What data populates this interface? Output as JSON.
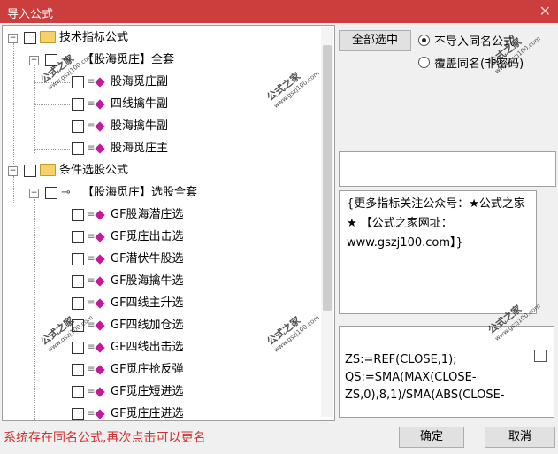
{
  "window": {
    "title": "导入公式",
    "close_glyph": "✕"
  },
  "tree": {
    "groups": [
      {
        "label": "技术指标公式",
        "sub": {
          "label": "【股海觅庄】全套",
          "items": [
            "股海觅庄副",
            "四线擒牛副",
            "股海擒牛副",
            "股海觅庄主"
          ]
        }
      },
      {
        "label": "条件选股公式",
        "sub": {
          "label": "【股海觅庄】选股全套",
          "items": [
            "GF股海潜庄选",
            "GF觅庄出击选",
            "GF潜伏牛股选",
            "GF股海擒牛选",
            "GF四线主升选",
            "GF四线加仓选",
            "GF四线出击选",
            "GF觅庄抢反弹",
            "GF觅庄短进选",
            "GF觅庄庄进选"
          ]
        }
      }
    ]
  },
  "watermark": {
    "main": "公式之家",
    "url": "www.gszj100.com"
  },
  "right": {
    "select_all": "全部选中",
    "options": [
      {
        "label": "不导入同名公式",
        "checked": true
      },
      {
        "label": "覆盖同名(非密码)",
        "checked": false
      }
    ],
    "description": "{更多指标关注公众号：★公式之家★ 【公式之家网址：www.gszj100.com】}",
    "code_lines": [
      "ZS:=REF(CLOSE,1);",
      "QS:=SMA(MAX(CLOSE-",
      "ZS,0),8,1)/SMA(ABS(CLOSE-"
    ]
  },
  "footer": {
    "status": "系统存在同名公式,再次点击可以更名",
    "ok": "确定",
    "cancel": "取消"
  },
  "colors": {
    "title_bar": "#cc3d3d",
    "status_text": "#d03030",
    "item_icon": "#c21a9b",
    "folder": "#f5d36a"
  }
}
